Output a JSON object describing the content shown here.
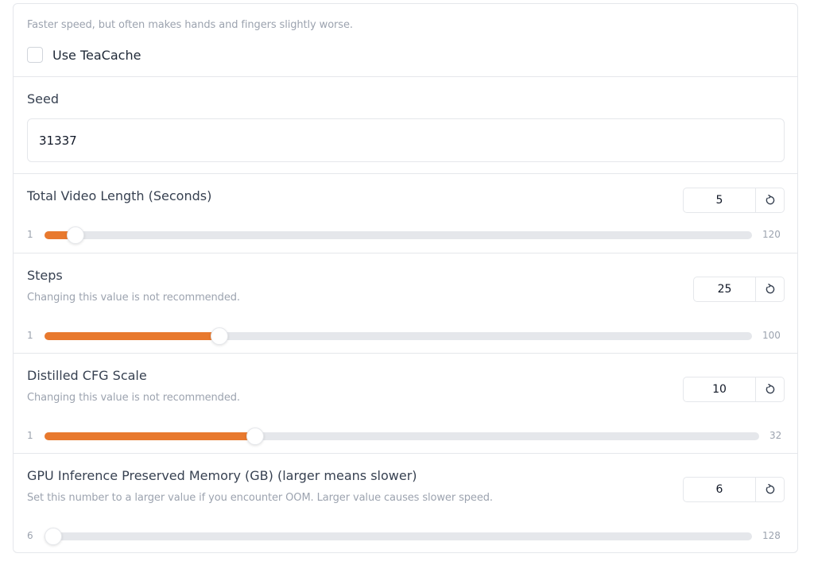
{
  "teacache": {
    "info": "Faster speed, but often makes hands and fingers slightly worse.",
    "checkbox_label": "Use TeaCache",
    "checked": false
  },
  "seed": {
    "label": "Seed",
    "value": "31337"
  },
  "sliders": [
    {
      "label": "Total Video Length (Seconds)",
      "info": "",
      "value": "5",
      "min": "1",
      "max": "120",
      "accent": "#e8792e"
    },
    {
      "label": "Steps",
      "info": "Changing this value is not recommended.",
      "value": "25",
      "min": "1",
      "max": "100",
      "accent": "#e8792e"
    },
    {
      "label": "Distilled CFG Scale",
      "info": "Changing this value is not recommended.",
      "value": "10",
      "min": "1",
      "max": "32",
      "accent": "#e8792e"
    },
    {
      "label": "GPU Inference Preserved Memory (GB) (larger means slower)",
      "info": "Set this number to a larger value if you encounter OOM. Larger value causes slower speed.",
      "value": "6",
      "min": "6",
      "max": "128",
      "accent": "#e8792e"
    }
  ],
  "icons": {
    "reset": "reset-icon"
  }
}
